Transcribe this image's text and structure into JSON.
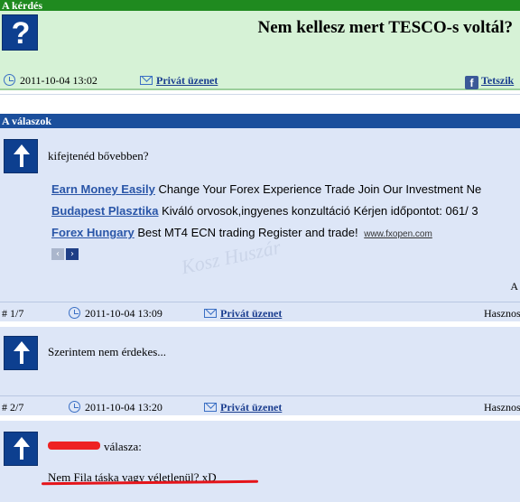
{
  "question": {
    "section_title": "A kérdés",
    "icon": "question-mark-icon",
    "title": "Nem kellesz mert TESCO-s voltál?",
    "date": "2011-10-04 13:02",
    "private_message": "Privát üzenet",
    "like": "Tetszik"
  },
  "answers_section": {
    "title": "A válaszok"
  },
  "answers": [
    {
      "text": "kifejtenéd bővebben?",
      "number": "# 1/7",
      "date": "2011-10-04 13:09",
      "private_message": "Privát üzenet",
      "useful": "Hasznos",
      "trailing_letter": "A"
    },
    {
      "text": "Szerintem nem érdekes...",
      "number": "# 2/7",
      "date": "2011-10-04 13:20",
      "private_message": "Privát üzenet",
      "useful": "Hasznos"
    },
    {
      "reply_label": "válasza:",
      "text": "Nem Fila táska vagy véletlenül? xD"
    }
  ],
  "ads": [
    {
      "title": "Earn Money Easily",
      "text": "Change Your Forex Experience Trade Join Our Investment Ne"
    },
    {
      "title": "Budapest Plasztika",
      "text": "Kiváló orvosok,ingyenes konzultáció Kérjen időpontot: 061/ 3"
    },
    {
      "title": "Forex Hungary",
      "text": "Best MT4 ECN trading Register and trade!",
      "url": "www.fxopen.com"
    }
  ],
  "watermark": "Kosz Huszár",
  "colors": {
    "question_header": "#1f8a1f",
    "question_bg": "#d6f2d6",
    "answers_header": "#1b4f9c",
    "answer_bg": "#dde6f7",
    "link": "#1a3d8f",
    "annotation_red": "#e5141a"
  }
}
